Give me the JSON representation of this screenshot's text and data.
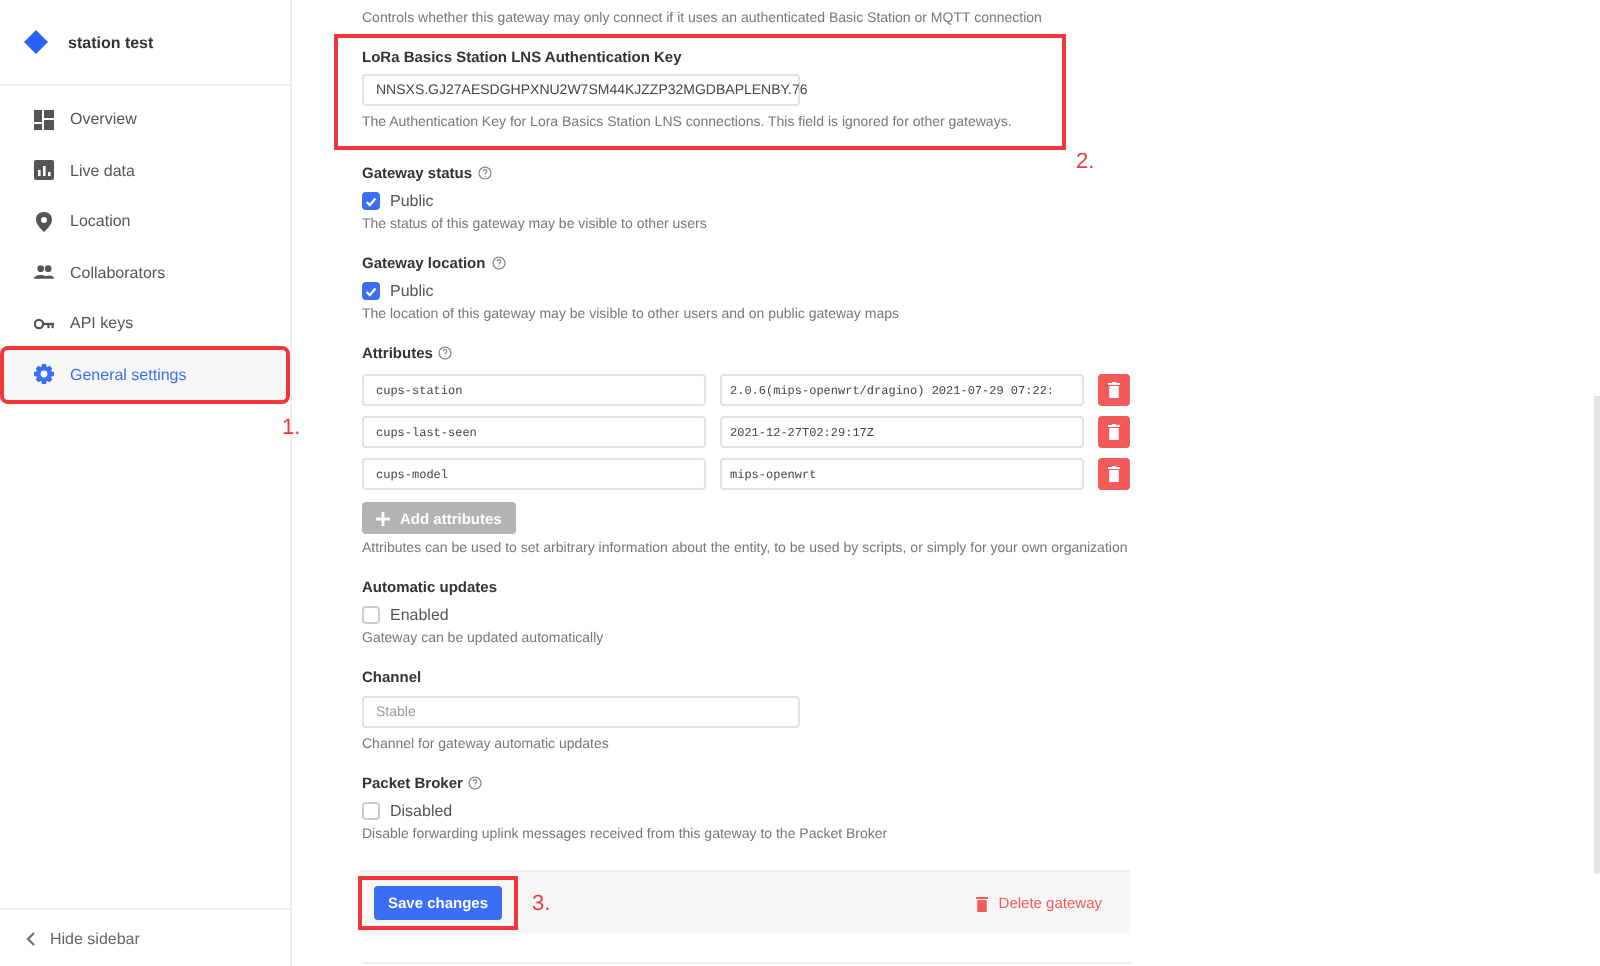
{
  "sidebar": {
    "title": "station test",
    "items": [
      {
        "label": "Overview",
        "selected": false
      },
      {
        "label": "Live data",
        "selected": false
      },
      {
        "label": "Location",
        "selected": false
      },
      {
        "label": "Collaborators",
        "selected": false
      },
      {
        "label": "API keys",
        "selected": false
      },
      {
        "label": "General settings",
        "selected": true,
        "annotation": "1."
      }
    ],
    "hide_label": "Hide sidebar"
  },
  "top_hint": "Controls whether this gateway may only connect if it uses an authenticated Basic Station or MQTT connection",
  "lns_key": {
    "label": "LoRa Basics Station LNS Authentication Key",
    "value": "NNSXS.GJ27AESDGHPXNU2W7SM44KJZZP32MGDBAPLENBY.76",
    "hint": "The Authentication Key for Lora Basics Station LNS connections. This field is ignored for other gateways.",
    "annotation": "2."
  },
  "gateway_status": {
    "label": "Gateway status",
    "help": true,
    "option": "Public",
    "checked": true,
    "hint": "The status of this gateway may be visible to other users"
  },
  "gateway_location": {
    "label": "Gateway location",
    "help": true,
    "option": "Public",
    "checked": true,
    "hint": "The location of this gateway may be visible to other users and on public gateway maps"
  },
  "attributes": {
    "label": "Attributes",
    "help": true,
    "rows": [
      {
        "key": "cups-station",
        "value": "2.0.6(mips-openwrt/dragino) 2021-07-29 07:22:"
      },
      {
        "key": "cups-last-seen",
        "value": "2021-12-27T02:29:17Z"
      },
      {
        "key": "cups-model",
        "value": "mips-openwrt"
      }
    ],
    "add_button": "Add attributes",
    "hint": "Attributes can be used to set arbitrary information about the entity, to be used by scripts, or simply for your own organization"
  },
  "automatic_updates": {
    "label": "Automatic updates",
    "option": "Enabled",
    "checked": false,
    "hint": "Gateway can be updated automatically"
  },
  "channel": {
    "label": "Channel",
    "placeholder": "Stable",
    "hint": "Channel for gateway automatic updates"
  },
  "packet_broker": {
    "label": "Packet Broker",
    "help": true,
    "option": "Disabled",
    "checked": false,
    "hint": "Disable forwarding uplink messages received from this gateway to the Packet Broker"
  },
  "footer": {
    "save_button": "Save changes",
    "save_annotation": "3.",
    "delete_button": "Delete gateway"
  }
}
